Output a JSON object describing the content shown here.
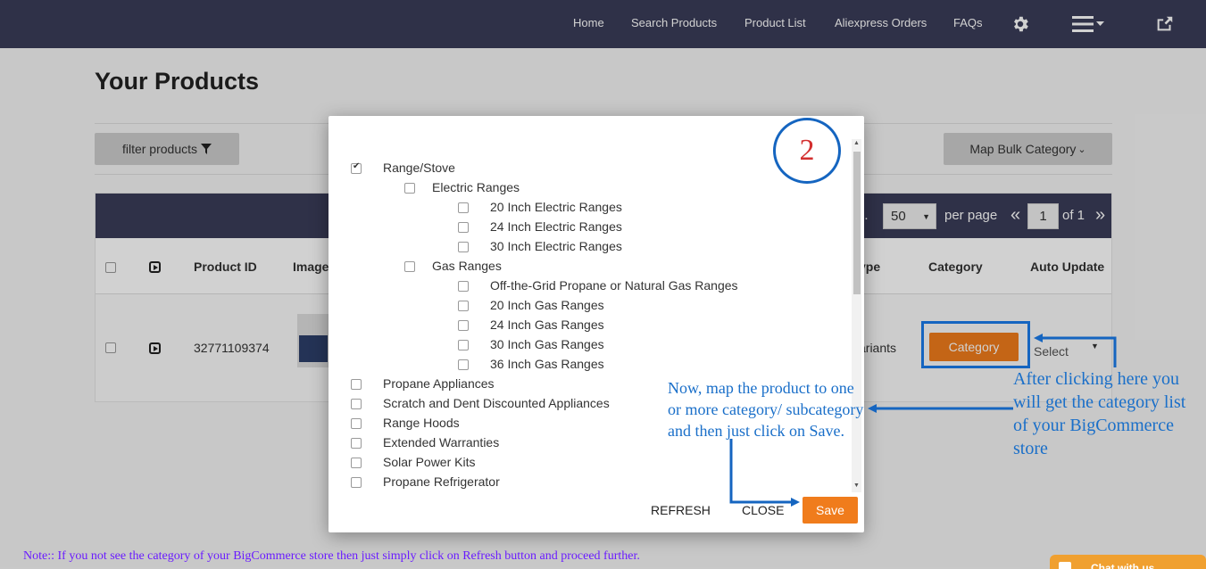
{
  "nav": {
    "items": [
      "Home",
      "Search Products",
      "Product List",
      "Aliexpress Orders",
      "FAQs"
    ],
    "icons": [
      "gear-icon",
      "hamburger-menu-icon",
      "share-icon"
    ]
  },
  "page": {
    "title": "Your Products",
    "filter_button": "filter products",
    "bulk_button": "Map Bulk Category",
    "per_page_value": "50",
    "per_page_label": "per page",
    "page_prev": "«",
    "page_current": "1",
    "page_of": "of 1",
    "page_next": "»",
    "show_partial": "n.",
    "columns": [
      "Product ID",
      "Image",
      "ype",
      "Category",
      "Auto Update"
    ],
    "row": {
      "product_id": "32771109374",
      "variants_partial": "ariants",
      "category_button": "Category",
      "auto_update": "Select"
    }
  },
  "modal": {
    "categories": [
      {
        "label": "Range/Stove",
        "level": 0,
        "checked": true
      },
      {
        "label": "Electric Ranges",
        "level": 1,
        "checked": false
      },
      {
        "label": "20 Inch Electric Ranges",
        "level": 2,
        "checked": false
      },
      {
        "label": "24 Inch Electric Ranges",
        "level": 2,
        "checked": false
      },
      {
        "label": "30 Inch Electric Ranges",
        "level": 2,
        "checked": false
      },
      {
        "label": "Gas Ranges",
        "level": 1,
        "checked": false
      },
      {
        "label": "Off-the-Grid Propane or Natural Gas Ranges",
        "level": 2,
        "checked": false
      },
      {
        "label": "20 Inch Gas Ranges",
        "level": 2,
        "checked": false
      },
      {
        "label": "24 Inch Gas Ranges",
        "level": 2,
        "checked": false
      },
      {
        "label": "30 Inch Gas Ranges",
        "level": 2,
        "checked": false
      },
      {
        "label": "36 Inch Gas Ranges",
        "level": 2,
        "checked": false
      },
      {
        "label": "Propane Appliances",
        "level": 0,
        "checked": false
      },
      {
        "label": "Scratch and Dent Discounted Appliances",
        "level": 0,
        "checked": false
      },
      {
        "label": "Range Hoods",
        "level": 0,
        "checked": false
      },
      {
        "label": "Extended Warranties",
        "level": 0,
        "checked": false
      },
      {
        "label": "Solar Power Kits",
        "level": 0,
        "checked": false
      },
      {
        "label": "Propane Refrigerator",
        "level": 0,
        "checked": false
      }
    ],
    "refresh_label": "REFRESH",
    "close_label": "CLOSE",
    "save_label": "Save"
  },
  "annotations": {
    "step_number": "2",
    "map_text": "Now, map the product to one or more category/ subcategory and then just click on Save.",
    "category_text": "After clicking here you will get the category list of your BigCommerce store",
    "note": "Note:: If you not see the category of your BigCommerce store then just simply click on Refresh button and proceed further.",
    "chat_label": "Chat with us"
  },
  "colors": {
    "nav_bg": "#3a3c58",
    "accent_orange": "#f07c1c",
    "annotation_blue": "#1565c0",
    "badge_red": "#d32f2f",
    "note_purple": "#6a1bff"
  }
}
